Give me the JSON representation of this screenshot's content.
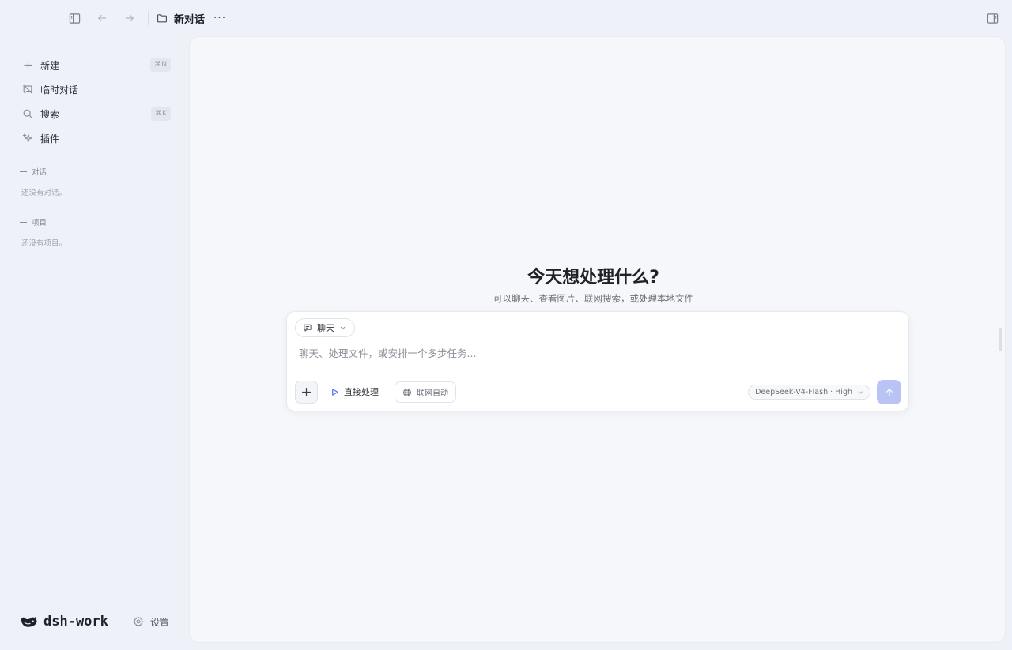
{
  "topbar": {
    "title": "新对话",
    "more_label": "···"
  },
  "sidebar": {
    "items": [
      {
        "label": "新建",
        "shortcut": "⌘N",
        "icon": "plus-icon"
      },
      {
        "label": "临时对话",
        "icon": "incognito-chat-icon"
      },
      {
        "label": "搜索",
        "shortcut": "⌘K",
        "icon": "search-icon"
      },
      {
        "label": "插件",
        "icon": "sparkle-icon"
      }
    ],
    "sections": {
      "conversations": {
        "title": "对话",
        "empty": "还没有对话。"
      },
      "projects": {
        "title": "项目",
        "empty": "还没有项目。"
      }
    },
    "brand": {
      "name": "dsh-work",
      "icon": "whale-logo-icon"
    },
    "settings_label": "设置"
  },
  "main": {
    "headline": "今天想处理什么?",
    "subline": "可以聊天、查看图片、联网搜索，或处理本地文件",
    "composer": {
      "mode_label": "聊天",
      "placeholder": "聊天、处理文件，或安排一个多步任务...",
      "value": "",
      "direct_label": "直接处理",
      "web_label": "联网自动",
      "model_label": "DeepSeek-V4-Flash · High"
    }
  },
  "colors": {
    "background": "#eef1f7",
    "panel": "#f6f7fa",
    "send_button": "#b9c4f5",
    "accent": "#4c6ef5"
  }
}
